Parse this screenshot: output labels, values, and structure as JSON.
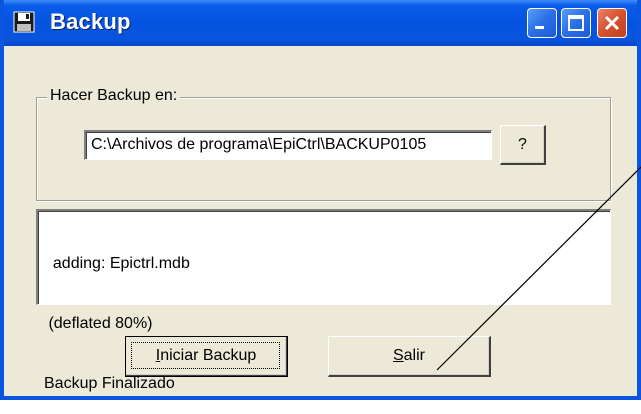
{
  "window": {
    "title": "Backup",
    "icon": "floppy-disk-icon",
    "controls": [
      "minimize-icon",
      "maximize-icon",
      "close-icon"
    ]
  },
  "group": {
    "legend": "Hacer Backup en:",
    "path_value": "C:\\Archivos de programa\\EpiCtrl\\BACKUP0105",
    "browse_label": "?"
  },
  "log": {
    "lines": [
      "  adding: Epictrl.mdb",
      " (deflated 80%)",
      "Backup Finalizado"
    ]
  },
  "buttons": {
    "start": {
      "mnemonic": "I",
      "rest": "niciar Backup"
    },
    "exit": {
      "mnemonic": "S",
      "rest": "alir"
    }
  },
  "colors": {
    "titlebar": "#0453e0",
    "frame": "#0b55e0",
    "face": "#ece9d8",
    "close_button": "#d5512e"
  }
}
